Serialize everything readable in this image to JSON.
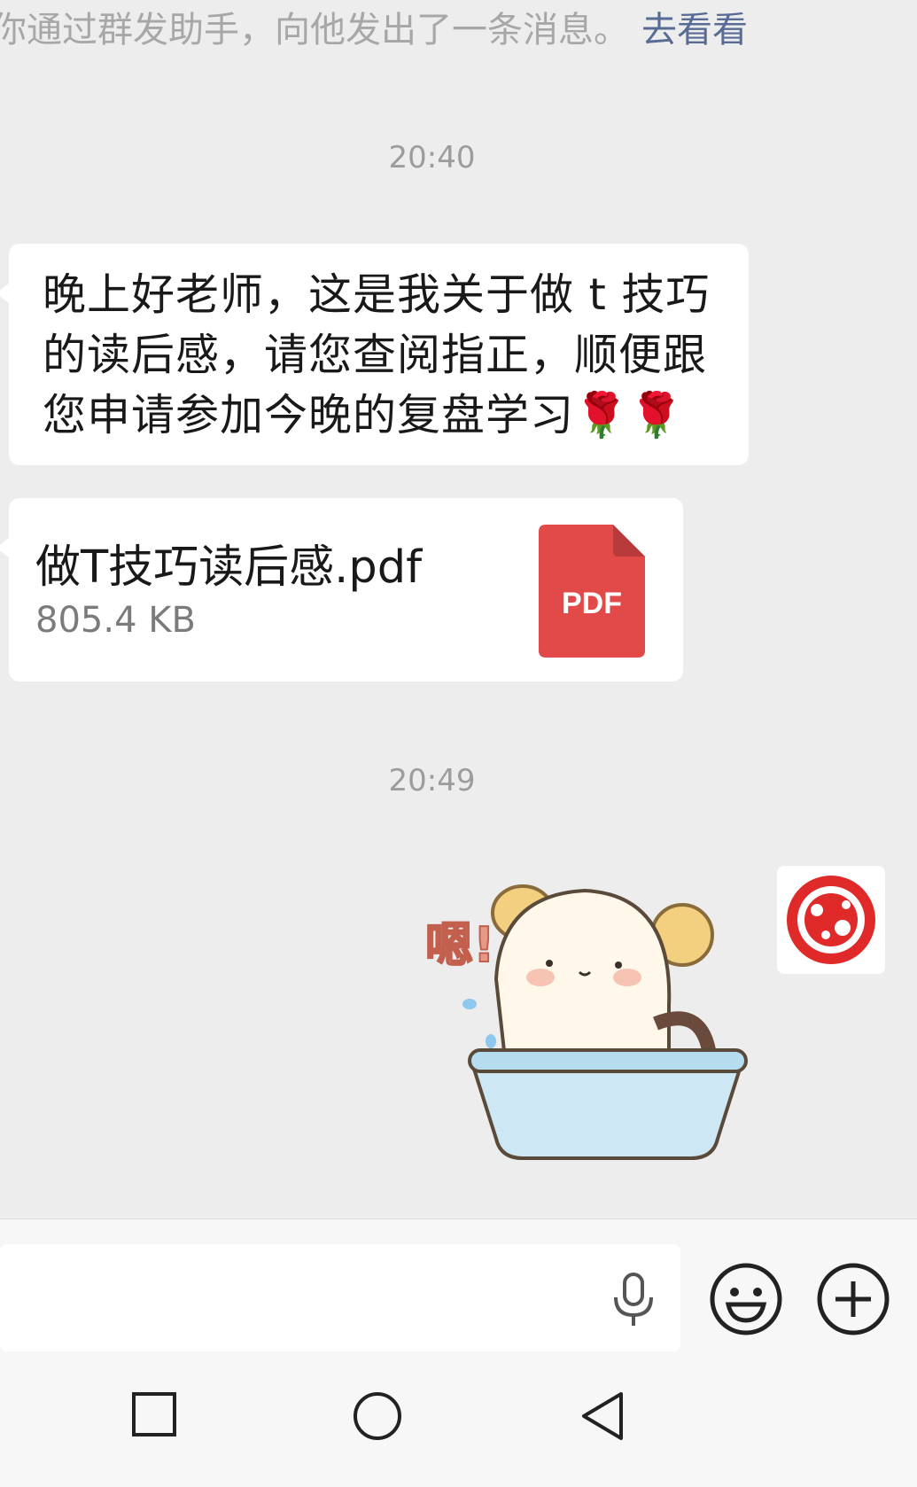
{
  "system_notice": {
    "text": "你通过群发助手，向他发出了一条消息。",
    "link_label": "去看看"
  },
  "messages": {
    "time_1": "20:40",
    "text_message": "晚上好老师，这是我关于做 t 技巧的读后感，请您查阅指正，顺便跟您申请参加今晚的复盘学习🌹🌹",
    "file": {
      "name": "做T技巧读后感.pdf",
      "size": "805.4 KB",
      "icon_label": "PDF",
      "icon_color": "#e24a4a"
    },
    "time_2": "20:49",
    "sticker_text": "嗯!"
  },
  "composer": {
    "voice_icon": "microphone-icon",
    "emoji_icon": "smiley-icon",
    "more_icon": "plus-circle-icon"
  },
  "navbar": {
    "recents_icon": "square-icon",
    "home_icon": "circle-icon",
    "back_icon": "triangle-back-icon"
  },
  "colors": {
    "background": "#ededed",
    "link": "#576b95",
    "bubble": "#ffffff"
  }
}
